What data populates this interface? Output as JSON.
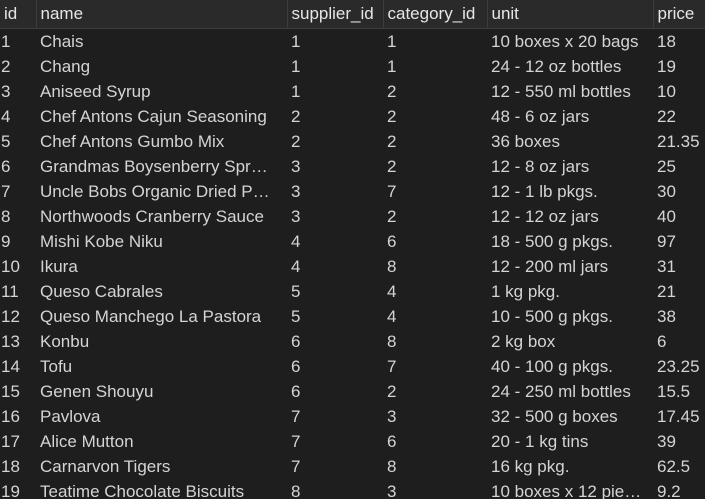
{
  "table": {
    "columns": [
      "id",
      "name",
      "supplier_id",
      "category_id",
      "unit",
      "price"
    ],
    "rows": [
      [
        "1",
        "Chais",
        "1",
        "1",
        "10 boxes x 20 bags",
        "18"
      ],
      [
        "2",
        "Chang",
        "1",
        "1",
        "24 - 12 oz bottles",
        "19"
      ],
      [
        "3",
        "Aniseed Syrup",
        "1",
        "2",
        "12 - 550 ml bottles",
        "10"
      ],
      [
        "4",
        "Chef Antons Cajun Seasoning",
        "2",
        "2",
        "48 - 6 oz jars",
        "22"
      ],
      [
        "5",
        "Chef Antons Gumbo Mix",
        "2",
        "2",
        "36 boxes",
        "21.35"
      ],
      [
        "6",
        "Grandmas Boysenberry Spr…",
        "3",
        "2",
        "12 - 8 oz jars",
        "25"
      ],
      [
        "7",
        "Uncle Bobs Organic Dried P…",
        "3",
        "7",
        "12 - 1 lb pkgs.",
        "30"
      ],
      [
        "8",
        "Northwoods Cranberry Sauce",
        "3",
        "2",
        "12 - 12 oz jars",
        "40"
      ],
      [
        "9",
        "Mishi Kobe Niku",
        "4",
        "6",
        "18 - 500 g pkgs.",
        "97"
      ],
      [
        "10",
        "Ikura",
        "4",
        "8",
        "12 - 200 ml jars",
        "31"
      ],
      [
        "11",
        "Queso Cabrales",
        "5",
        "4",
        "1 kg pkg.",
        "21"
      ],
      [
        "12",
        "Queso Manchego La Pastora",
        "5",
        "4",
        "10 - 500 g pkgs.",
        "38"
      ],
      [
        "13",
        "Konbu",
        "6",
        "8",
        "2 kg box",
        "6"
      ],
      [
        "14",
        "Tofu",
        "6",
        "7",
        "40 - 100 g pkgs.",
        "23.25"
      ],
      [
        "15",
        "Genen Shouyu",
        "6",
        "2",
        "24 - 250 ml bottles",
        "15.5"
      ],
      [
        "16",
        "Pavlova",
        "7",
        "3",
        "32 - 500 g boxes",
        "17.45"
      ],
      [
        "17",
        "Alice Mutton",
        "7",
        "6",
        "20 - 1 kg tins",
        "39"
      ],
      [
        "18",
        "Carnarvon Tigers",
        "7",
        "8",
        "16 kg pkg.",
        "62.5"
      ],
      [
        "19",
        "Teatime Chocolate Biscuits",
        "8",
        "3",
        "10 boxes x 12 pie…",
        "9.2"
      ]
    ]
  },
  "colors": {
    "background": "#1e1e1e",
    "header_background": "#2a2a2a",
    "text": "#d4d4d4",
    "grid_line": "#3d3d3d"
  }
}
